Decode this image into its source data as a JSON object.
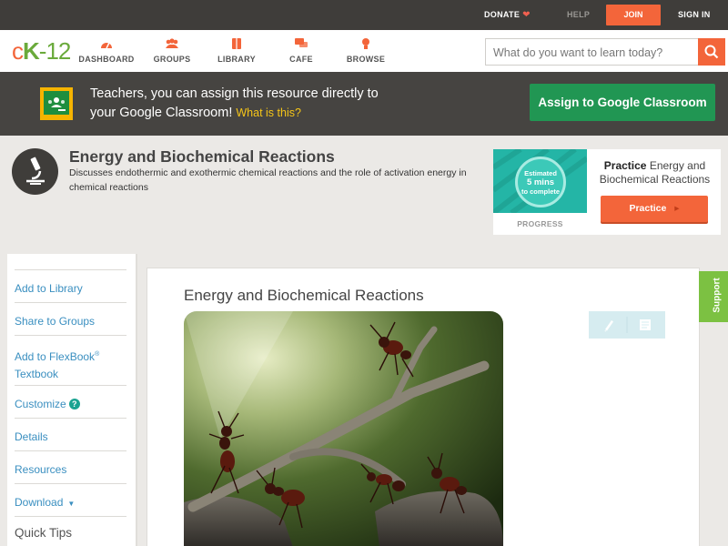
{
  "topbar": {
    "donate": "DONATE",
    "help": "HELP",
    "join": "JOIN",
    "signin": "SIGN IN"
  },
  "logo": {
    "c": "c",
    "k": "K",
    "dash": "-",
    "num": "12"
  },
  "nav": [
    {
      "label": "DASHBOARD",
      "icon": "dashboard-icon"
    },
    {
      "label": "GROUPS",
      "icon": "groups-icon"
    },
    {
      "label": "LIBRARY",
      "icon": "library-icon"
    },
    {
      "label": "CAFE",
      "icon": "cafe-icon"
    },
    {
      "label": "BROWSE",
      "icon": "browse-icon"
    }
  ],
  "search": {
    "placeholder": "What do you want to learn today?"
  },
  "classroom": {
    "line1": "Teachers, you can assign this resource directly to",
    "line2": "your Google Classroom!",
    "what": "What is this?",
    "assign": "Assign to Google Classroom"
  },
  "header": {
    "title": "Energy and Biochemical Reactions",
    "description": "Discusses endothermic and exothermic chemical reactions and the role of activation energy in chemical reactions"
  },
  "practice": {
    "estimated": "Estimated",
    "mins": "5 mins",
    "to_complete": "to complete",
    "progress": "PROGRESS",
    "title_bold": "Practice",
    "title_rest": "Energy and Biochemical Reactions",
    "button": "Practice"
  },
  "sidebar": {
    "add_library": "Add to Library",
    "share_groups": "Share to Groups",
    "add_flexbook": "Add to FlexBook",
    "reg": "®",
    "textbook": "Textbook",
    "customize": "Customize",
    "q": "?",
    "details": "Details",
    "resources": "Resources",
    "download": "Download",
    "quick_tips": "Quick Tips"
  },
  "main": {
    "title": "Energy and Biochemical Reactions"
  },
  "support": "Support",
  "colors": {
    "brand_orange": "#f3653a",
    "brand_green": "#6aaa3b",
    "classroom_green": "#219653",
    "link_blue": "#3a8fc0"
  }
}
